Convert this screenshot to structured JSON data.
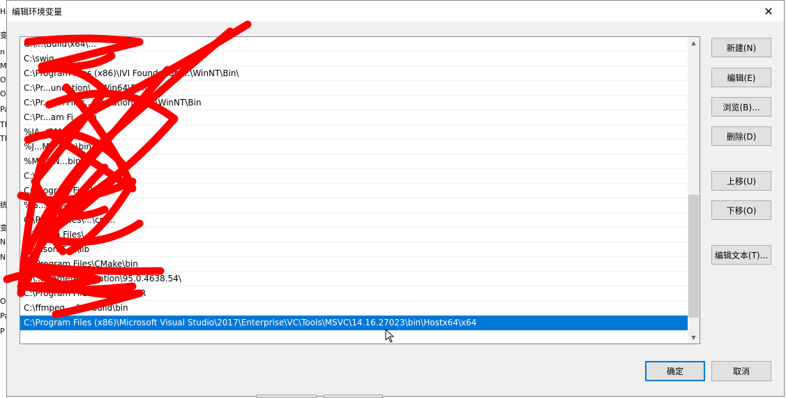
{
  "background_window": {
    "fragments": [
      "H",
      "变",
      "n",
      "M",
      "O",
      "O",
      "Pa",
      "TE",
      "TM",
      "统",
      "变",
      "N",
      "N",
      "O",
      "Pa",
      "P"
    ]
  },
  "dialog": {
    "title": "编辑环境变量",
    "close_glyph": "✕"
  },
  "list": {
    "items": [
      "C:\\...\\Build\\x64\\...",
      "C:\\swig...",
      "C:\\Program Files (x86)\\IVI Foundation\\...\\WinNT\\Bin\\",
      "C:\\Pr...undation\\...\\Win64\\Bin\\",
      "C:\\Pr...am Files...\\undation\\VISA\\WinNT\\Bin",
      "C:\\Pr...am Fi...\\bin",
      "%JA...OM...%\\",
      "%J...ME%...e\\bin",
      "%M...ON...bin",
      "C:\\...",
      "C:\\...ogram Fi...\\bin",
      "%G...A...%\\",
      "C:\\P...am Files\\...\\cm...",
      "C:\\P...am Files\\...",
      "C:\\...sorRT-...\\lib",
      "C:\\Program Files\\CMake\\bin",
      "C:\\...hrome\\Application\\95.0.4638.54\\",
      "C:\\Program Files\\Tesser...OCR",
      "C:\\ffmpeg...-full-build\\bin",
      "C:\\Program Files (x86)\\Microsoft Visual Studio\\2017\\Enterprise\\VC\\Tools\\MSVC\\14.16.27023\\bin\\Hostx64\\x64"
    ],
    "selected_index": 19
  },
  "buttons": {
    "new": "新建(N)",
    "edit": "编辑(E)",
    "browse": "浏览(B)...",
    "delete": "删除(D)",
    "move_up": "上移(U)",
    "move_down": "下移(O)",
    "edit_text": "编辑文本(T)...",
    "ok": "确定",
    "cancel": "取消"
  },
  "icons": {
    "close": "close-icon",
    "scroll_up": "scroll-up-arrow-icon",
    "scroll_down": "scroll-down-arrow-icon",
    "cursor": "mouse-pointer-icon"
  },
  "colors": {
    "selection": "#0078d7",
    "scribble": "#ff0000"
  }
}
